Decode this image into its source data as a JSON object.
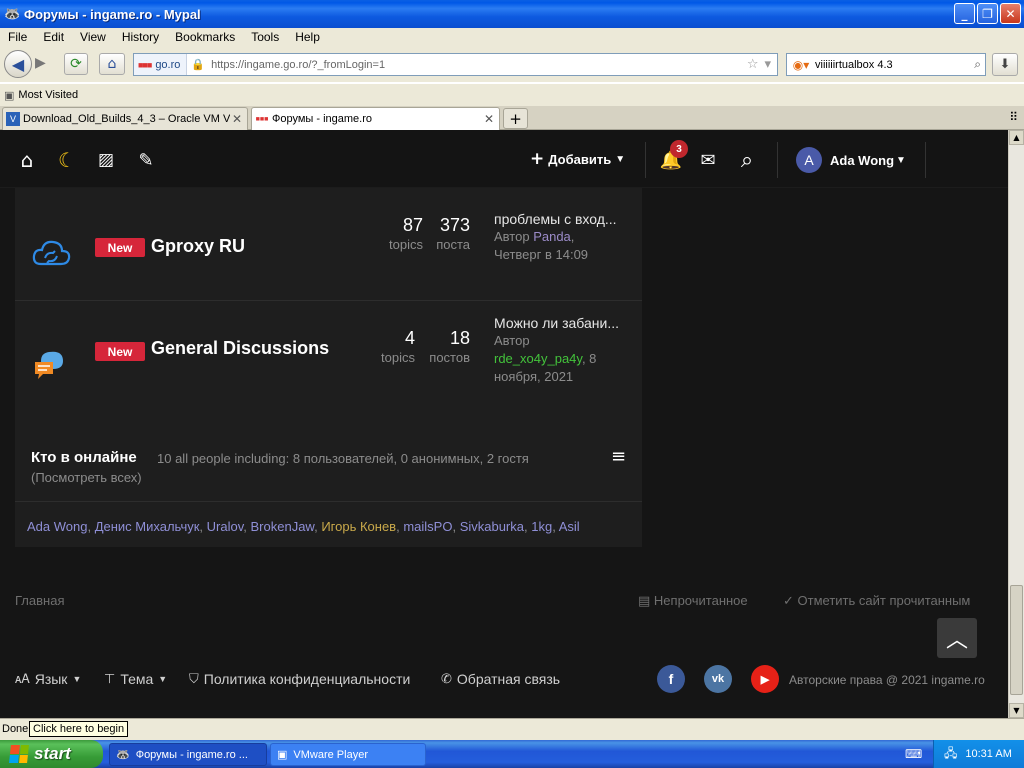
{
  "window": {
    "title": "Форумы - ingame.ro - Mypal"
  },
  "menu": [
    "File",
    "Edit",
    "View",
    "History",
    "Bookmarks",
    "Tools",
    "Help"
  ],
  "nav": {
    "site_badge": "go.ro",
    "url": "https://ingame.go.ro/?_fromLogin=1",
    "search_value": "viiiiiirtualbox 4.3"
  },
  "bookmarks": {
    "item": "Most Visited"
  },
  "tabs": [
    {
      "label": "Download_Old_Builds_4_3 – Oracle VM Vi...",
      "active": false
    },
    {
      "label": "Форумы - ingame.ro",
      "active": true
    }
  ],
  "site": {
    "add_label": "Добавить",
    "notifications_count": "3",
    "user": {
      "initial": "A",
      "name": "Ada Wong"
    },
    "forums": [
      {
        "badge": "New",
        "title": "Gproxy RU",
        "topics": "87",
        "topics_label": "topics",
        "posts": "373",
        "posts_label": "поста",
        "last_title": "проблемы с вход...",
        "last_author_prefix": "Автор",
        "last_author": "Panda",
        "last_date": "Четверг в 14:09"
      },
      {
        "badge": "New",
        "title": "General Discussions",
        "topics": "4",
        "topics_label": "topics",
        "posts": "18",
        "posts_label": "постов",
        "last_title": "Можно ли забани...",
        "last_author_prefix": "Автор",
        "last_author": "rde_xo4y_pa4y",
        "last_date_a": "8",
        "last_date_b": "ноября, 2021"
      }
    ],
    "online": {
      "title": "Кто в онлайне",
      "summary": "10 all people including: 8 пользователей, 0 анонимных, 2 гостя",
      "view_all": "(Посмотреть всех)",
      "users": [
        "Ada Wong",
        "Денис Михальчук",
        "Uralov",
        "BrokenJaw",
        "Игорь Конев",
        "mailsPO",
        "Sivkaburka",
        "1kg",
        "Asil"
      ]
    },
    "footer": {
      "home": "Главная",
      "unread": "Непрочитанное",
      "mark_read": "Отметить сайт прочитанным",
      "language": "Язык",
      "theme": "Тема",
      "privacy": "Политика конфиденциальности",
      "contact": "Обратная связь",
      "copyright": "Авторские права @ 2021 ingame.ro"
    }
  },
  "status": {
    "text": "Done",
    "tooltip": "Click here to begin"
  },
  "taskbar": {
    "start": "start",
    "tasks": [
      "Форумы - ingame.ro ...",
      "VMware Player"
    ],
    "clock": "10:31 AM"
  }
}
